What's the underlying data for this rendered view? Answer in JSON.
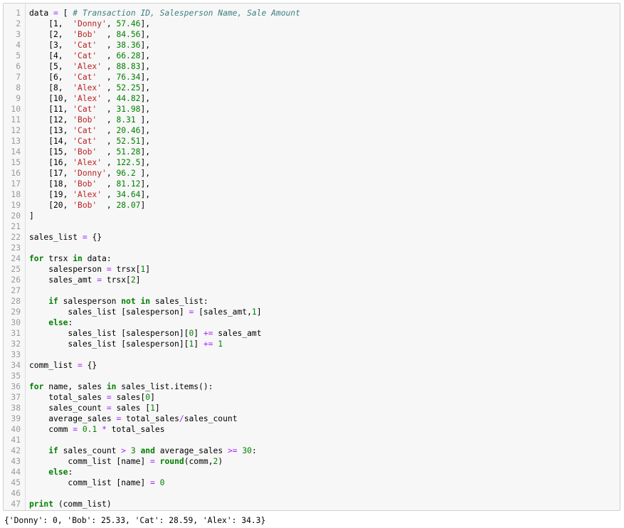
{
  "colors": {
    "keyword": "#008000",
    "string": "#ba2121",
    "number": "#008000",
    "operator": "#aa22ff",
    "comment": "#408080",
    "line_number": "#999999",
    "cell_background": "#f7f7f7",
    "cell_border": "#cfcfcf"
  },
  "code_cell": {
    "lines": [
      {
        "n": "1",
        "tokens": [
          [
            "txt",
            "data "
          ],
          [
            "op",
            "="
          ],
          [
            "txt",
            " [ "
          ],
          [
            "comment",
            "# Transaction ID, Salesperson Name, Sale Amount"
          ]
        ]
      },
      {
        "n": "2",
        "tokens": [
          [
            "txt",
            "    [1,  "
          ],
          [
            "str",
            "'Donny'"
          ],
          [
            "txt",
            ", "
          ],
          [
            "num",
            "57.46"
          ],
          [
            "txt",
            "],"
          ]
        ]
      },
      {
        "n": "3",
        "tokens": [
          [
            "txt",
            "    [2,  "
          ],
          [
            "str",
            "'Bob'"
          ],
          [
            "txt",
            "  , "
          ],
          [
            "num",
            "84.56"
          ],
          [
            "txt",
            "],"
          ]
        ]
      },
      {
        "n": "4",
        "tokens": [
          [
            "txt",
            "    [3,  "
          ],
          [
            "str",
            "'Cat'"
          ],
          [
            "txt",
            "  , "
          ],
          [
            "num",
            "38.36"
          ],
          [
            "txt",
            "],"
          ]
        ]
      },
      {
        "n": "5",
        "tokens": [
          [
            "txt",
            "    [4,  "
          ],
          [
            "str",
            "'Cat'"
          ],
          [
            "txt",
            "  , "
          ],
          [
            "num",
            "66.28"
          ],
          [
            "txt",
            "],"
          ]
        ]
      },
      {
        "n": "6",
        "tokens": [
          [
            "txt",
            "    [5,  "
          ],
          [
            "str",
            "'Alex'"
          ],
          [
            "txt",
            " , "
          ],
          [
            "num",
            "88.83"
          ],
          [
            "txt",
            "],"
          ]
        ]
      },
      {
        "n": "7",
        "tokens": [
          [
            "txt",
            "    [6,  "
          ],
          [
            "str",
            "'Cat'"
          ],
          [
            "txt",
            "  , "
          ],
          [
            "num",
            "76.34"
          ],
          [
            "txt",
            "],"
          ]
        ]
      },
      {
        "n": "8",
        "tokens": [
          [
            "txt",
            "    [8,  "
          ],
          [
            "str",
            "'Alex'"
          ],
          [
            "txt",
            " , "
          ],
          [
            "num",
            "52.25"
          ],
          [
            "txt",
            "],"
          ]
        ]
      },
      {
        "n": "9",
        "tokens": [
          [
            "txt",
            "    [10, "
          ],
          [
            "str",
            "'Alex'"
          ],
          [
            "txt",
            " , "
          ],
          [
            "num",
            "44.82"
          ],
          [
            "txt",
            "],"
          ]
        ]
      },
      {
        "n": "10",
        "tokens": [
          [
            "txt",
            "    [11, "
          ],
          [
            "str",
            "'Cat'"
          ],
          [
            "txt",
            "  , "
          ],
          [
            "num",
            "31.98"
          ],
          [
            "txt",
            "],"
          ]
        ]
      },
      {
        "n": "11",
        "tokens": [
          [
            "txt",
            "    [12, "
          ],
          [
            "str",
            "'Bob'"
          ],
          [
            "txt",
            "  , "
          ],
          [
            "num",
            "8.31"
          ],
          [
            "txt",
            " ],"
          ]
        ]
      },
      {
        "n": "12",
        "tokens": [
          [
            "txt",
            "    [13, "
          ],
          [
            "str",
            "'Cat'"
          ],
          [
            "txt",
            "  , "
          ],
          [
            "num",
            "20.46"
          ],
          [
            "txt",
            "],"
          ]
        ]
      },
      {
        "n": "13",
        "tokens": [
          [
            "txt",
            "    [14, "
          ],
          [
            "str",
            "'Cat'"
          ],
          [
            "txt",
            "  , "
          ],
          [
            "num",
            "52.51"
          ],
          [
            "txt",
            "],"
          ]
        ]
      },
      {
        "n": "14",
        "tokens": [
          [
            "txt",
            "    [15, "
          ],
          [
            "str",
            "'Bob'"
          ],
          [
            "txt",
            "  , "
          ],
          [
            "num",
            "51.28"
          ],
          [
            "txt",
            "],"
          ]
        ]
      },
      {
        "n": "15",
        "tokens": [
          [
            "txt",
            "    [16, "
          ],
          [
            "str",
            "'Alex'"
          ],
          [
            "txt",
            " , "
          ],
          [
            "num",
            "122.5"
          ],
          [
            "txt",
            "],"
          ]
        ]
      },
      {
        "n": "16",
        "tokens": [
          [
            "txt",
            "    [17, "
          ],
          [
            "str",
            "'Donny'"
          ],
          [
            "txt",
            ", "
          ],
          [
            "num",
            "96.2"
          ],
          [
            "txt",
            " ],"
          ]
        ]
      },
      {
        "n": "17",
        "tokens": [
          [
            "txt",
            "    [18, "
          ],
          [
            "str",
            "'Bob'"
          ],
          [
            "txt",
            "  , "
          ],
          [
            "num",
            "81.12"
          ],
          [
            "txt",
            "],"
          ]
        ]
      },
      {
        "n": "18",
        "tokens": [
          [
            "txt",
            "    [19, "
          ],
          [
            "str",
            "'Alex'"
          ],
          [
            "txt",
            " , "
          ],
          [
            "num",
            "34.64"
          ],
          [
            "txt",
            "],"
          ]
        ]
      },
      {
        "n": "19",
        "tokens": [
          [
            "txt",
            "    [20, "
          ],
          [
            "str",
            "'Bob'"
          ],
          [
            "txt",
            "  , "
          ],
          [
            "num",
            "28.07"
          ],
          [
            "txt",
            "]"
          ]
        ]
      },
      {
        "n": "20",
        "tokens": [
          [
            "txt",
            "]"
          ]
        ]
      },
      {
        "n": "21",
        "tokens": []
      },
      {
        "n": "22",
        "tokens": [
          [
            "txt",
            "sales_list "
          ],
          [
            "op",
            "="
          ],
          [
            "txt",
            " {}"
          ]
        ]
      },
      {
        "n": "23",
        "tokens": []
      },
      {
        "n": "24",
        "tokens": [
          [
            "kw",
            "for"
          ],
          [
            "txt",
            " trsx "
          ],
          [
            "kw",
            "in"
          ],
          [
            "txt",
            " data:"
          ]
        ]
      },
      {
        "n": "25",
        "tokens": [
          [
            "txt",
            "    salesperson "
          ],
          [
            "op",
            "="
          ],
          [
            "txt",
            " trsx["
          ],
          [
            "num",
            "1"
          ],
          [
            "txt",
            "]"
          ]
        ]
      },
      {
        "n": "26",
        "tokens": [
          [
            "txt",
            "    sales_amt "
          ],
          [
            "op",
            "="
          ],
          [
            "txt",
            " trsx["
          ],
          [
            "num",
            "2"
          ],
          [
            "txt",
            "]"
          ]
        ]
      },
      {
        "n": "27",
        "tokens": []
      },
      {
        "n": "28",
        "tokens": [
          [
            "txt",
            "    "
          ],
          [
            "kw",
            "if"
          ],
          [
            "txt",
            " salesperson "
          ],
          [
            "kw",
            "not in"
          ],
          [
            "txt",
            " sales_list:"
          ]
        ]
      },
      {
        "n": "29",
        "tokens": [
          [
            "txt",
            "        sales_list [salesperson] "
          ],
          [
            "op",
            "="
          ],
          [
            "txt",
            " [sales_amt,"
          ],
          [
            "num",
            "1"
          ],
          [
            "txt",
            "]"
          ]
        ]
      },
      {
        "n": "30",
        "tokens": [
          [
            "txt",
            "    "
          ],
          [
            "kw",
            "else"
          ],
          [
            "txt",
            ":"
          ]
        ]
      },
      {
        "n": "31",
        "tokens": [
          [
            "txt",
            "        sales_list [salesperson]["
          ],
          [
            "num",
            "0"
          ],
          [
            "txt",
            "] "
          ],
          [
            "op",
            "+="
          ],
          [
            "txt",
            " sales_amt"
          ]
        ]
      },
      {
        "n": "32",
        "tokens": [
          [
            "txt",
            "        sales_list [salesperson]["
          ],
          [
            "num",
            "1"
          ],
          [
            "txt",
            "] "
          ],
          [
            "op",
            "+="
          ],
          [
            "txt",
            " "
          ],
          [
            "num",
            "1"
          ]
        ]
      },
      {
        "n": "33",
        "tokens": []
      },
      {
        "n": "34",
        "tokens": [
          [
            "txt",
            "comm_list "
          ],
          [
            "op",
            "="
          ],
          [
            "txt",
            " {}"
          ]
        ]
      },
      {
        "n": "35",
        "tokens": []
      },
      {
        "n": "36",
        "tokens": [
          [
            "kw",
            "for"
          ],
          [
            "txt",
            " name, sales "
          ],
          [
            "kw",
            "in"
          ],
          [
            "txt",
            " sales_list.items():"
          ]
        ]
      },
      {
        "n": "37",
        "tokens": [
          [
            "txt",
            "    total_sales "
          ],
          [
            "op",
            "="
          ],
          [
            "txt",
            " sales["
          ],
          [
            "num",
            "0"
          ],
          [
            "txt",
            "]"
          ]
        ]
      },
      {
        "n": "38",
        "tokens": [
          [
            "txt",
            "    sales_count "
          ],
          [
            "op",
            "="
          ],
          [
            "txt",
            " sales ["
          ],
          [
            "num",
            "1"
          ],
          [
            "txt",
            "]"
          ]
        ]
      },
      {
        "n": "39",
        "tokens": [
          [
            "txt",
            "    average_sales "
          ],
          [
            "op",
            "="
          ],
          [
            "txt",
            " total_sales"
          ],
          [
            "op",
            "/"
          ],
          [
            "txt",
            "sales_count"
          ]
        ]
      },
      {
        "n": "40",
        "tokens": [
          [
            "txt",
            "    comm "
          ],
          [
            "op",
            "="
          ],
          [
            "txt",
            " "
          ],
          [
            "num",
            "0.1"
          ],
          [
            "txt",
            " "
          ],
          [
            "op",
            "*"
          ],
          [
            "txt",
            " total_sales"
          ]
        ]
      },
      {
        "n": "41",
        "tokens": []
      },
      {
        "n": "42",
        "tokens": [
          [
            "txt",
            "    "
          ],
          [
            "kw",
            "if"
          ],
          [
            "txt",
            " sales_count "
          ],
          [
            "op",
            ">"
          ],
          [
            "txt",
            " "
          ],
          [
            "num",
            "3"
          ],
          [
            "txt",
            " "
          ],
          [
            "kw",
            "and"
          ],
          [
            "txt",
            " average_sales "
          ],
          [
            "op",
            ">="
          ],
          [
            "txt",
            " "
          ],
          [
            "num",
            "30"
          ],
          [
            "txt",
            ":"
          ]
        ]
      },
      {
        "n": "43",
        "tokens": [
          [
            "txt",
            "        comm_list [name] "
          ],
          [
            "op",
            "="
          ],
          [
            "txt",
            " "
          ],
          [
            "kw",
            "round"
          ],
          [
            "txt",
            "(comm,"
          ],
          [
            "num",
            "2"
          ],
          [
            "txt",
            ")"
          ]
        ]
      },
      {
        "n": "44",
        "tokens": [
          [
            "txt",
            "    "
          ],
          [
            "kw",
            "else"
          ],
          [
            "txt",
            ":"
          ]
        ]
      },
      {
        "n": "45",
        "tokens": [
          [
            "txt",
            "        comm_list [name] "
          ],
          [
            "op",
            "="
          ],
          [
            "txt",
            " "
          ],
          [
            "num",
            "0"
          ]
        ]
      },
      {
        "n": "46",
        "tokens": []
      },
      {
        "n": "47",
        "tokens": [
          [
            "kw",
            "print"
          ],
          [
            "txt",
            " (comm_list)"
          ]
        ]
      }
    ]
  },
  "output": {
    "text": "{'Donny': 0, 'Bob': 25.33, 'Cat': 28.59, 'Alex': 34.3}"
  }
}
